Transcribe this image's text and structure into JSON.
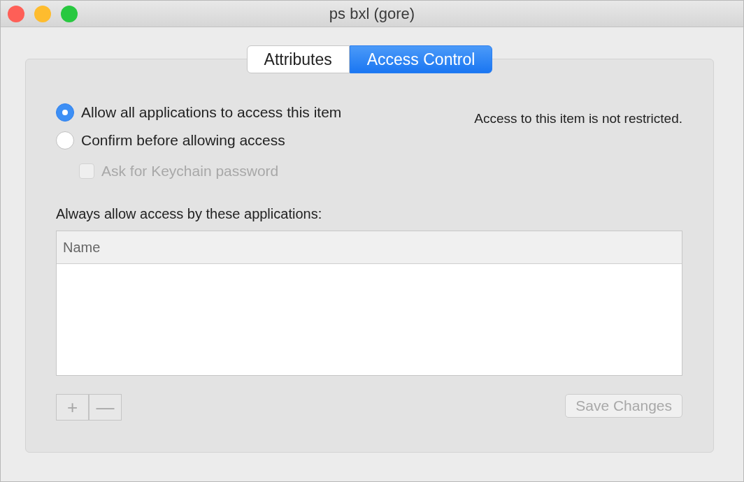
{
  "window": {
    "title": "ps bxl (gore)"
  },
  "tabs": [
    {
      "label": "Attributes",
      "selected": false
    },
    {
      "label": "Access Control",
      "selected": true
    }
  ],
  "options": [
    {
      "kind": "radio",
      "label": "Allow all applications to access this item",
      "selected": true
    },
    {
      "kind": "radio",
      "label": "Confirm before allowing access",
      "selected": false
    },
    {
      "kind": "checkbox",
      "label": "Ask for Keychain password",
      "checked": false,
      "disabled": true
    }
  ],
  "status": "Access to this item is not restricted.",
  "list_label": "Always allow access by these applications:",
  "table": {
    "columns": [
      "Name"
    ]
  },
  "buttons": {
    "add": {
      "label": "+",
      "disabled": true
    },
    "remove": {
      "label": "—",
      "disabled": true
    },
    "save": {
      "label": "Save Changes",
      "disabled": true
    }
  }
}
